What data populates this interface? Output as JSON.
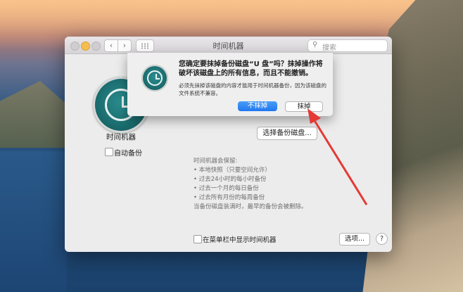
{
  "window": {
    "title": "时间机器",
    "search_placeholder": "搜索",
    "nav_back": "‹",
    "nav_forward": "›"
  },
  "left_pane": {
    "app_name": "时间机器",
    "auto_backup_label": "自动备份",
    "auto_backup_checked": false
  },
  "right_pane": {
    "select_disk_button": "选择备份磁盘...",
    "keeps_title": "时间机器会保留:",
    "keeps_items": [
      "• 本地快照（只要空间允许）",
      "• 过去24小时的每小时备份",
      "• 过去一个月的每日备份",
      "• 过去所有月份的每周备份"
    ],
    "note": "当备份磁盘装满时，最早的备份会被删除。",
    "show_in_menubar_label": "在菜单栏中显示时间机器",
    "show_in_menubar_checked": false,
    "options_button": "选项...",
    "help_button": "?"
  },
  "sheet": {
    "title": "您确定要抹掉备份磁盘“U 盘”吗？抹掉操作将破坏该磁盘上的所有信息，而且不能撤销。",
    "message": "必须先抹掉该磁盘的内容才能用于时间机器备份，因为该磁盘的文件系统不兼容。",
    "dont_erase_button": "不抹掉",
    "erase_button": "抹掉"
  },
  "colors": {
    "accent_blue": "#1f78ef",
    "pointer_red": "#e53935",
    "time_machine_teal": "#1b6e70"
  },
  "icons": {
    "search": "magnifier-icon",
    "grid": "grid-icon",
    "time_machine": "time-machine-icon"
  }
}
